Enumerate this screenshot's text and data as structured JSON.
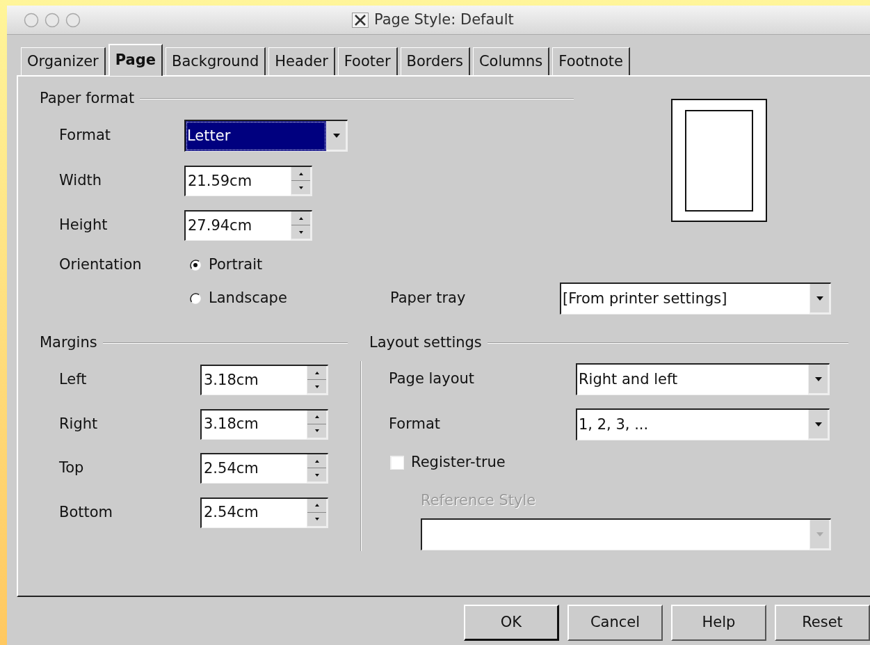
{
  "window": {
    "title": "Page Style: Default"
  },
  "tabs": [
    {
      "label": "Organizer",
      "selected": false
    },
    {
      "label": "Page",
      "selected": true
    },
    {
      "label": "Background",
      "selected": false
    },
    {
      "label": "Header",
      "selected": false
    },
    {
      "label": "Footer",
      "selected": false
    },
    {
      "label": "Borders",
      "selected": false
    },
    {
      "label": "Columns",
      "selected": false
    },
    {
      "label": "Footnote",
      "selected": false
    }
  ],
  "paper_format": {
    "heading": "Paper format",
    "format": {
      "label": "Format",
      "value": "Letter",
      "highlighted": true
    },
    "width": {
      "label": "Width",
      "value": "21.59cm"
    },
    "height": {
      "label": "Height",
      "value": "27.94cm"
    },
    "orientation": {
      "label": "Orientation",
      "options": [
        {
          "label": "Portrait",
          "selected": true
        },
        {
          "label": "Landscape",
          "selected": false
        }
      ]
    },
    "paper_tray": {
      "label": "Paper tray",
      "value": "[From printer settings]"
    }
  },
  "margins": {
    "heading": "Margins",
    "fields": [
      {
        "label": "Left",
        "value": "3.18cm"
      },
      {
        "label": "Right",
        "value": "3.18cm"
      },
      {
        "label": "Top",
        "value": "2.54cm"
      },
      {
        "label": "Bottom",
        "value": "2.54cm"
      }
    ]
  },
  "layout_settings": {
    "heading": "Layout settings",
    "page_layout": {
      "label": "Page layout",
      "value": "Right and left"
    },
    "format": {
      "label": "Format",
      "value": "1, 2, 3, ..."
    },
    "register_true": {
      "label": "Register-true",
      "checked": false
    },
    "reference_style": {
      "label": "Reference Style",
      "disabled": true
    }
  },
  "buttons": [
    {
      "label": "OK",
      "default": true
    },
    {
      "label": "Cancel",
      "default": false
    },
    {
      "label": "Help",
      "default": false
    },
    {
      "label": "Reset",
      "default": false
    }
  ]
}
